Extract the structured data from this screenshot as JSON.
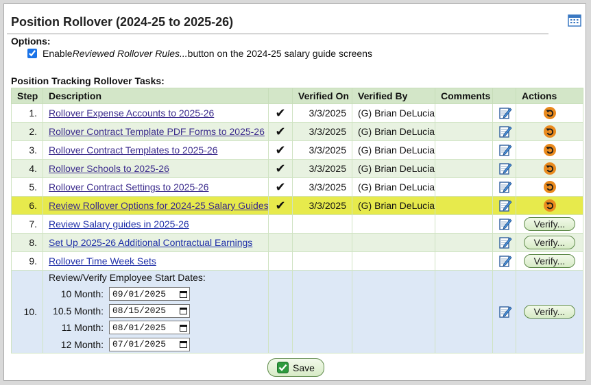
{
  "page": {
    "title": "Position Rollover (2024-25 to 2025-26)"
  },
  "options": {
    "heading": "Options:",
    "enable_checked": true,
    "enable_prefix": "Enable ",
    "enable_em": "Reviewed Rollover Rules...",
    "enable_suffix": " button on the 2024-25 salary guide screens"
  },
  "tasks": {
    "heading": "Position Tracking Rollover Tasks:",
    "columns": {
      "step": "Step",
      "description": "Description",
      "verified_on": "Verified On",
      "verified_by": "Verified By",
      "comments": "Comments",
      "actions": "Actions"
    },
    "rows": [
      {
        "step": "1.",
        "description": "Rollover Expense Accounts to 2025-26",
        "check": "✔",
        "verified_on": "3/3/2025",
        "verified_by": "(G) Brian DeLucia",
        "comments": ""
      },
      {
        "step": "2.",
        "description": "Rollover Contract Template PDF Forms to 2025-26",
        "check": "✔",
        "verified_on": "3/3/2025",
        "verified_by": "(G) Brian DeLucia",
        "comments": ""
      },
      {
        "step": "3.",
        "description": "Rollover Contract Templates to 2025-26",
        "check": "✔",
        "verified_on": "3/3/2025",
        "verified_by": "(G) Brian DeLucia",
        "comments": ""
      },
      {
        "step": "4.",
        "description": "Rollover Schools to 2025-26",
        "check": "✔",
        "verified_on": "3/3/2025",
        "verified_by": "(G) Brian DeLucia",
        "comments": ""
      },
      {
        "step": "5.",
        "description": "Rollover Contract Settings to 2025-26",
        "check": "✔",
        "verified_on": "3/3/2025",
        "verified_by": "(G) Brian DeLucia",
        "comments": ""
      },
      {
        "step": "6.",
        "description": "Review Rollover Options for 2024-25 Salary Guides",
        "check": "✔",
        "verified_on": "3/3/2025",
        "verified_by": "(G) Brian DeLucia",
        "comments": ""
      },
      {
        "step": "7.",
        "description": "Review Salary guides in 2025-26",
        "action": "Verify..."
      },
      {
        "step": "8.",
        "description": "Set Up 2025-26 Additional Contractual Earnings",
        "action": "Verify..."
      },
      {
        "step": "9.",
        "description": "Rollover Time Week Sets",
        "action": "Verify..."
      }
    ],
    "row10": {
      "step": "10.",
      "title": "Review/Verify Employee Start Dates:",
      "dates": [
        {
          "label": "10 Month:",
          "value": "09/01/2025"
        },
        {
          "label": "10.5 Month:",
          "value": "08/15/2025"
        },
        {
          "label": "11 Month:",
          "value": "08/01/2025"
        },
        {
          "label": "12 Month:",
          "value": "07/01/2025"
        }
      ],
      "action": "Verify..."
    }
  },
  "buttons": {
    "save": "Save"
  },
  "colors": {
    "header_green": "#d3e6c8",
    "row_green": "#e8f2e1",
    "highlight": "#e7ea4c",
    "row_blue": "#dde8f6",
    "undo_orange": "#e98a1e"
  },
  "icons": {
    "calendar": "calendar-icon",
    "edit": "edit-note-icon",
    "undo": "undo-icon",
    "check": "checkmark-icon",
    "save": "save-check-icon"
  }
}
